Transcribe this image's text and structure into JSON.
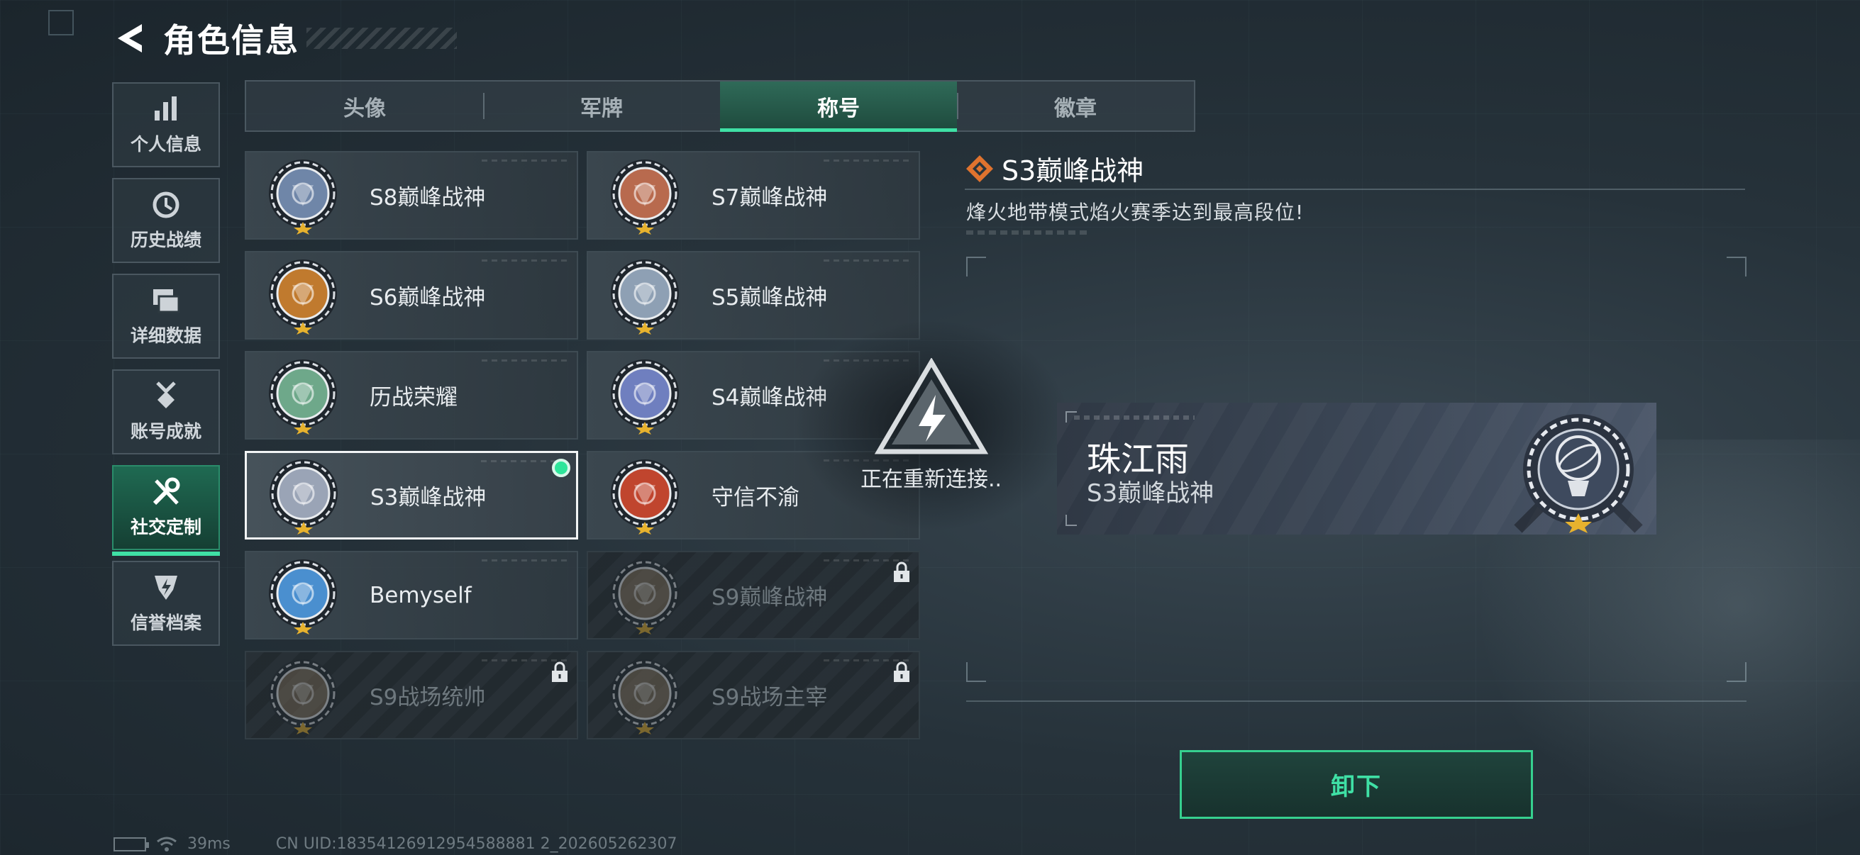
{
  "header": {
    "title": "角色信息"
  },
  "sidebar": {
    "items": [
      {
        "label": "个人信息",
        "icon": "bar-chart-icon"
      },
      {
        "label": "历史战绩",
        "icon": "history-clock-icon"
      },
      {
        "label": "详细数据",
        "icon": "folders-icon"
      },
      {
        "label": "账号成就",
        "icon": "medal-icon"
      },
      {
        "label": "社交定制",
        "icon": "wrench-screwdriver-icon",
        "active": true
      },
      {
        "label": "信誉档案",
        "icon": "shield-bolt-icon"
      }
    ]
  },
  "tabs": [
    {
      "label": "头像"
    },
    {
      "label": "军牌"
    },
    {
      "label": "称号",
      "active": true
    },
    {
      "label": "徽章"
    }
  ],
  "titles": [
    {
      "label": "S8巅峰战神",
      "badge": "s8-badge",
      "color": "#6f86a8"
    },
    {
      "label": "S7巅峰战神",
      "badge": "s7-badge",
      "color": "#b86a4e"
    },
    {
      "label": "S6巅峰战神",
      "badge": "s6-badge",
      "color": "#c07a2e"
    },
    {
      "label": "S5巅峰战神",
      "badge": "s5-badge",
      "color": "#8ea0b4"
    },
    {
      "label": "历战荣耀",
      "badge": "trophy-badge",
      "color": "#6ea88a"
    },
    {
      "label": "S4巅峰战神",
      "badge": "s4-badge",
      "color": "#6f7fbf"
    },
    {
      "label": "S3巅峰战神",
      "badge": "s3-badge",
      "color": "#9aa4b6",
      "selected": true,
      "equipped": true
    },
    {
      "label": "守信不渝",
      "badge": "scales-badge",
      "color": "#c0452e"
    },
    {
      "label": "Bemyself",
      "badge": "bemyself-badge",
      "color": "#4a8fcf"
    },
    {
      "label": "S9巅峰战神",
      "badge": "s9-badge",
      "color": "#7a6a55",
      "locked": true
    },
    {
      "label": "S9战场统帅",
      "badge": "s9-commander-badge",
      "color": "#7a6a55",
      "locked": true
    },
    {
      "label": "S9战场主宰",
      "badge": "s9-dominator-badge",
      "color": "#7a6a55",
      "locked": true
    }
  ],
  "detail": {
    "title": "S3巅峰战神",
    "description": "烽火地带模式焰火赛季达到最高段位!"
  },
  "nameplate": {
    "player_name": "珠江雨",
    "title": "S3巅峰战神"
  },
  "reconnect": {
    "text": "正在重新连接.."
  },
  "actions": {
    "unequip_label": "卸下"
  },
  "status": {
    "ping": "39ms",
    "uid": "CN UID:18354126912954588881 2_202605262307"
  },
  "colors": {
    "accent": "#3fe0a5",
    "active_bg": "#1f6a52",
    "equipped": "#2ee59a"
  }
}
